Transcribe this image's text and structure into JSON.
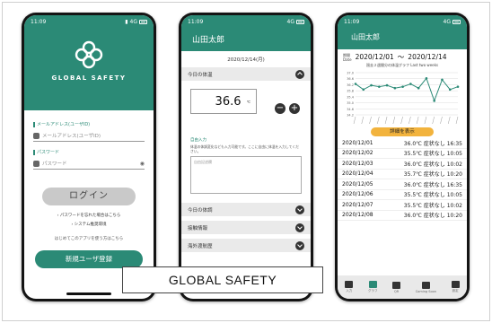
{
  "status": {
    "time": "11:09",
    "network": "4G"
  },
  "login": {
    "brand": "Global Safety",
    "email_label": "メールアドレス(ユーザID)",
    "email_placeholder": "メールアドレス(ユーザID)",
    "password_label": "パスワード",
    "password_placeholder": "パスワード",
    "login_button": "ログイン",
    "link_forgot": "パスワードを忘れた場合はこちら",
    "link_system": "システム推奨環境",
    "note": "はじめてこのアプリを使う方はこちら",
    "register_button": "新規ユーザ登録"
  },
  "entry": {
    "user": "山田太郎",
    "date": "2020/12/14(月)",
    "section_temp": "今日の体温",
    "temp_value": "36.6",
    "temp_unit": "℃",
    "memo_title": "自由入力",
    "memo_text": "体温の体調変化なども入力可能です。ここに自由に体温を入力してください。",
    "memo_placeholder": "自由記述欄",
    "sections": [
      "今日の体調",
      "接触情報",
      "海外渡航歴"
    ]
  },
  "history": {
    "user": "山田太郎",
    "period_label": "期間",
    "date_label": "Date",
    "from": "2020/12/01",
    "sep": "〜",
    "to": "2020/12/14",
    "subtitle": "過去２週間分の体温グラフ  Last two weeks",
    "show_button": "詳細を表示",
    "records": [
      {
        "date": "2020/12/01",
        "info": "36.0℃ 症状なし 16:35"
      },
      {
        "date": "2020/12/02",
        "info": "35.5℃ 症状なし 10:05"
      },
      {
        "date": "2020/12/03",
        "info": "36.0℃ 症状なし 10:02"
      },
      {
        "date": "2020/12/04",
        "info": "35.7℃ 症状なし 10:20"
      },
      {
        "date": "2020/12/05",
        "info": "36.0℃ 症状なし 16:35"
      },
      {
        "date": "2020/12/06",
        "info": "35.5℃ 症状なし 10:05"
      },
      {
        "date": "2020/12/07",
        "info": "35.5℃ 症状なし 10:02"
      },
      {
        "date": "2020/12/08",
        "info": "36.0℃ 症状なし 10:20"
      }
    ],
    "tabs": [
      "入力",
      "グラフ",
      "QR",
      "Coming Soon",
      "設定"
    ],
    "chart_data": {
      "type": "line",
      "ylim": [
        34.0,
        37.0
      ],
      "yticks": [
        "37.0",
        "36.6",
        "36.2",
        "35.8",
        "35.4",
        "35.0",
        "34.6",
        "34.2"
      ],
      "values": [
        36.2,
        35.8,
        36.1,
        36.0,
        36.1,
        35.9,
        36.0,
        36.2,
        35.9,
        36.6,
        35.0,
        36.5,
        35.8,
        36.0
      ]
    }
  },
  "caption": "GLOBAL SAFETY"
}
